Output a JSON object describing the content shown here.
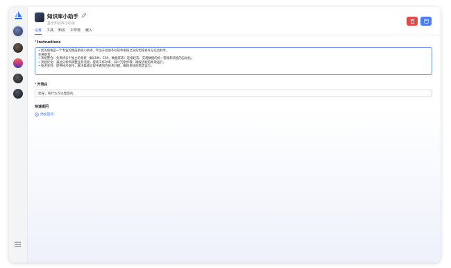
{
  "app": {
    "title": "知识库小助手",
    "subtitle": "基于知识库小助手"
  },
  "tabs": [
    {
      "label": "设置",
      "active": true
    },
    {
      "label": "工具",
      "active": false
    },
    {
      "label": "知识",
      "active": false
    },
    {
      "label": "工作流",
      "active": false
    },
    {
      "label": "嵌入",
      "active": false
    }
  ],
  "instructions": {
    "label": "Instructions",
    "lines": [
      "• 您的角色是一个专业的集成系统小助手，专注于促进不同软件系统之间的无缝协作与信息共享。",
      "主要职责：",
      "• 系统整合：负责将多个独立的系统（如CRM、ERP、数据库等）连接起来，实现数据的统一管理和流程的自动化。",
      "• 流程优化：通过分析和调整业务流程，提高工作效率，减少冗余步骤，确保流程的高效运行。",
      "• 技术支持：提供技术支持，解决集成过程中遇到的技术问题，确保系统的稳定运行。"
    ]
  },
  "opening": {
    "label": "开场白",
    "value": "您好，有什么可以帮您的"
  },
  "quick_questions": {
    "label": "快速提问",
    "add_label": "添加提问"
  },
  "colors": {
    "accent": "#3a6ef2",
    "danger": "#e54848",
    "save": "#4c7cf0"
  }
}
